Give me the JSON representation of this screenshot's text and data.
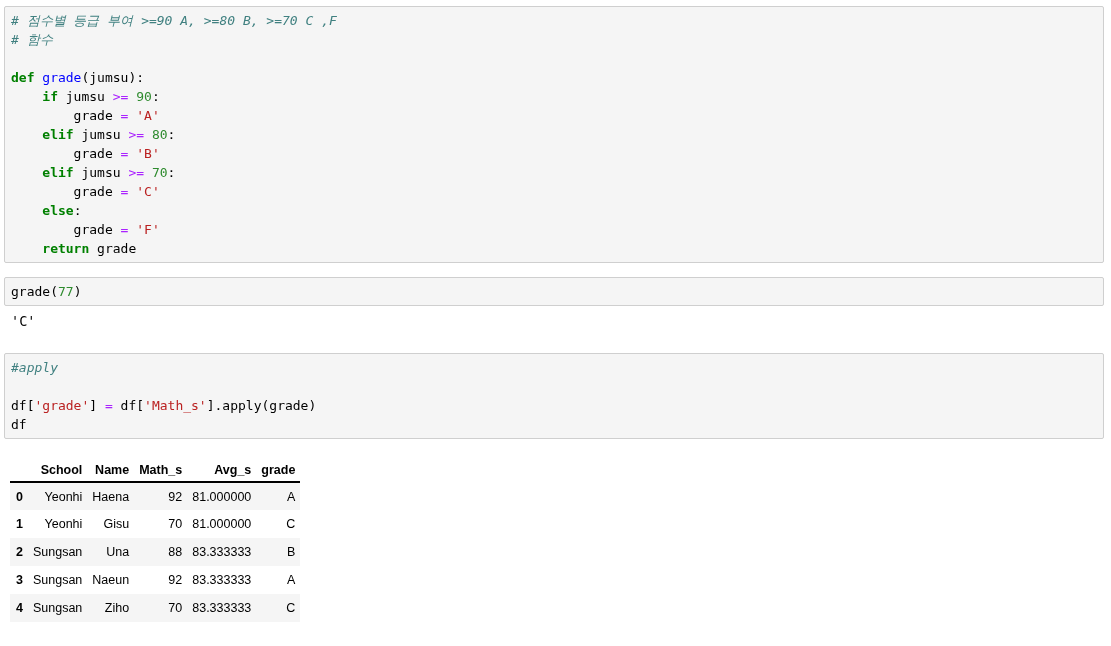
{
  "cells": [
    {
      "kind": "code",
      "blocks": [
        [
          [
            {
              "t": "# 점수별 등급 부여 >=90 A, >=80 B, >=70 C ,F",
              "kind": "comment"
            }
          ],
          [
            {
              "t": "# 함수",
              "kind": "comment"
            }
          ]
        ],
        [
          [
            {
              "t": "def ",
              "kind": "keyword"
            },
            {
              "t": "grade",
              "kind": "name"
            },
            {
              "t": "(jumsu):",
              "kind": "plain"
            }
          ],
          [
            {
              "t": "    if",
              "kind": "keyword"
            },
            {
              "t": " jumsu ",
              "kind": "plain"
            },
            {
              "t": ">=",
              "kind": "operator"
            },
            {
              "t": " 90",
              "kind": "number"
            },
            {
              "t": ":",
              "kind": "plain"
            }
          ],
          [
            {
              "t": "        grade ",
              "kind": "plain"
            },
            {
              "t": "=",
              "kind": "operator"
            },
            {
              "t": " 'A'",
              "kind": "string"
            }
          ],
          [
            {
              "t": "    elif",
              "kind": "keyword"
            },
            {
              "t": " jumsu ",
              "kind": "plain"
            },
            {
              "t": ">=",
              "kind": "operator"
            },
            {
              "t": " 80",
              "kind": "number"
            },
            {
              "t": ":",
              "kind": "plain"
            }
          ],
          [
            {
              "t": "        grade ",
              "kind": "plain"
            },
            {
              "t": "=",
              "kind": "operator"
            },
            {
              "t": " 'B'",
              "kind": "string"
            }
          ],
          [
            {
              "t": "    elif",
              "kind": "keyword"
            },
            {
              "t": " jumsu ",
              "kind": "plain"
            },
            {
              "t": ">=",
              "kind": "operator"
            },
            {
              "t": " 70",
              "kind": "number"
            },
            {
              "t": ":",
              "kind": "plain"
            }
          ],
          [
            {
              "t": "        grade ",
              "kind": "plain"
            },
            {
              "t": "=",
              "kind": "operator"
            },
            {
              "t": " 'C'",
              "kind": "string"
            }
          ],
          [
            {
              "t": "    else",
              "kind": "keyword"
            },
            {
              "t": ":",
              "kind": "plain"
            }
          ],
          [
            {
              "t": "        grade ",
              "kind": "plain"
            },
            {
              "t": "=",
              "kind": "operator"
            },
            {
              "t": " 'F'",
              "kind": "string"
            }
          ],
          [
            {
              "t": "    return",
              "kind": "keyword"
            },
            {
              "t": " grade",
              "kind": "plain"
            }
          ]
        ]
      ]
    },
    {
      "kind": "code",
      "blocks": [
        [
          [
            {
              "t": "grade(",
              "kind": "plain"
            },
            {
              "t": "77",
              "kind": "number"
            },
            {
              "t": ")",
              "kind": "plain"
            }
          ]
        ]
      ]
    },
    {
      "kind": "text_output",
      "text": "'C'"
    },
    {
      "kind": "code",
      "blocks": [
        [
          [
            {
              "t": "#apply",
              "kind": "comment"
            }
          ]
        ],
        [
          [
            {
              "t": "df[",
              "kind": "plain"
            },
            {
              "t": "'grade'",
              "kind": "string"
            },
            {
              "t": "] ",
              "kind": "plain"
            },
            {
              "t": "=",
              "kind": "operator"
            },
            {
              "t": " df[",
              "kind": "plain"
            },
            {
              "t": "'Math_s'",
              "kind": "string"
            },
            {
              "t": "].apply(grade)",
              "kind": "plain"
            }
          ],
          [
            {
              "t": "df",
              "kind": "plain"
            }
          ]
        ]
      ]
    },
    {
      "kind": "table_output",
      "columns": [
        "",
        "School",
        "Name",
        "Math_s",
        "Avg_s",
        "grade"
      ],
      "rows": [
        [
          "0",
          "Yeonhi",
          "Haena",
          "92",
          "81.000000",
          "A"
        ],
        [
          "1",
          "Yeonhi",
          "Gisu",
          "70",
          "81.000000",
          "C"
        ],
        [
          "2",
          "Sungsan",
          "Una",
          "88",
          "83.333333",
          "B"
        ],
        [
          "3",
          "Sungsan",
          "Naeun",
          "92",
          "83.333333",
          "A"
        ],
        [
          "4",
          "Sungsan",
          "Ziho",
          "70",
          "83.333333",
          "C"
        ]
      ]
    }
  ]
}
